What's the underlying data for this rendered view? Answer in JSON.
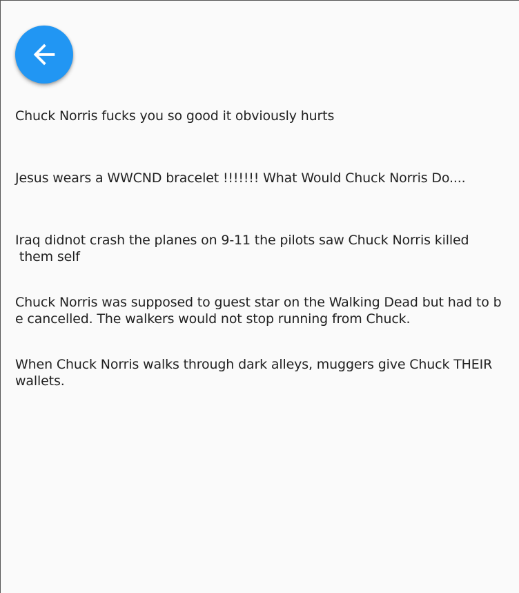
{
  "header": {
    "back_icon": "arrow-back-icon",
    "accent_color": "#2196f3"
  },
  "jokes": [
    "Chuck Norris fucks you so good it obviously hurts",
    "Jesus wears a WWCND bracelet !!!!!!! What Would Chuck Norris Do....",
    "Iraq didnot crash the planes on 9-11 the pilots saw Chuck Norris killed\n them self",
    "Chuck Norris was supposed to guest star on the Walking Dead but had to be cancelled. The walkers would not stop running from Chuck.",
    "When Chuck Norris walks through dark alleys, muggers give Chuck THEIR wallets."
  ]
}
